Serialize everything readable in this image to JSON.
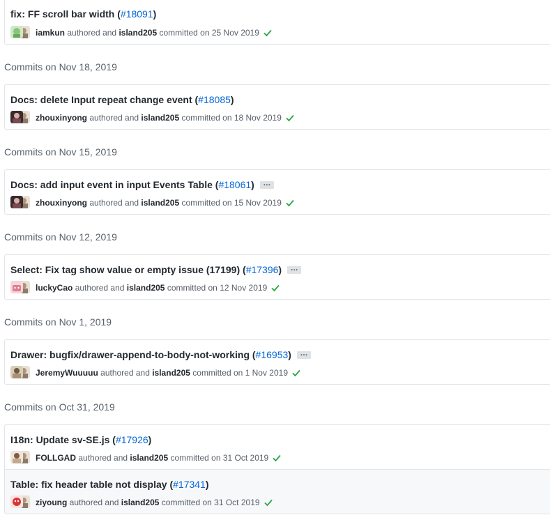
{
  "commits_top": {
    "title": "fix: FF scroll bar width (",
    "pr": "#18091",
    "title_end": ")",
    "author": "iamkun",
    "authored_text": "authored and",
    "committer": "island205",
    "committed_text": "committed on 25 Nov 2019"
  },
  "groups": [
    {
      "header": "Commits on Nov 18, 2019",
      "commits": [
        {
          "title": "Docs: delete Input repeat change event (",
          "pr": "#18085",
          "title_end": ")",
          "author": "zhouxinyong",
          "authored_text": "authored and",
          "committer": "island205",
          "committed_text": "committed on 18 Nov 2019"
        }
      ]
    },
    {
      "header": "Commits on Nov 15, 2019",
      "commits": [
        {
          "title": "Docs: add input event in input Events Table (",
          "pr": "#18061",
          "title_end": ")",
          "ellipsis": "…",
          "author": "zhouxinyong",
          "authored_text": "authored and",
          "committer": "island205",
          "committed_text": "committed on 15 Nov 2019"
        }
      ]
    },
    {
      "header": "Commits on Nov 12, 2019",
      "commits": [
        {
          "title": "Select: Fix tag show value or empty issue (17199) (",
          "pr": "#17396",
          "title_end": ")",
          "ellipsis": "…",
          "author": "luckyCao",
          "authored_text": "authored and",
          "committer": "island205",
          "committed_text": "committed on 12 Nov 2019"
        }
      ]
    },
    {
      "header": "Commits on Nov 1, 2019",
      "commits": [
        {
          "title": "Drawer: bugfix/drawer-append-to-body-not-working (",
          "pr": "#16953",
          "title_end": ")",
          "ellipsis": "…",
          "author": "JeremyWuuuuu",
          "authored_text": "authored and",
          "committer": "island205",
          "committed_text": "committed on 1 Nov 2019"
        }
      ]
    },
    {
      "header": "Commits on Oct 31, 2019",
      "commits": [
        {
          "title": "I18n: Update sv-SE.js (",
          "pr": "#17926",
          "title_end": ")",
          "author": "FOLLGAD",
          "authored_text": "authored and",
          "committer": "island205",
          "committed_text": "committed on 31 Oct 2019"
        },
        {
          "title": "Table: fix header table not display (",
          "pr": "#17341",
          "title_end": ")",
          "author": "ziyoung",
          "authored_text": "authored and",
          "committer": "island205",
          "committed_text": "committed on 31 Oct 2019"
        }
      ]
    }
  ],
  "colors": {
    "link": "#0366d6",
    "check": "#28a745",
    "border": "#e1e4e8"
  },
  "icons": {
    "status": "check-icon",
    "avatar": "user-avatar"
  }
}
